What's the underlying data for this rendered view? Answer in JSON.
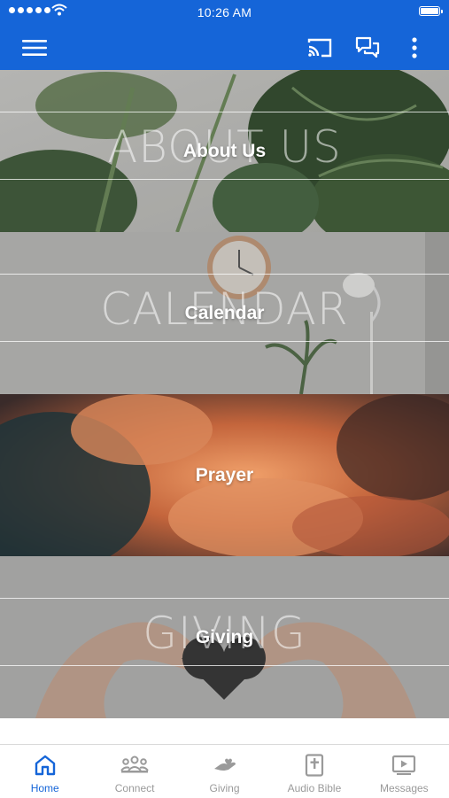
{
  "status_bar": {
    "time": "10:26 AM"
  },
  "nav": {
    "icons": [
      "menu-icon",
      "cast-icon",
      "chat-icon",
      "more-icon"
    ]
  },
  "tiles": [
    {
      "label": "About Us",
      "ghost": "ABOUT US",
      "scene": "monstera leaves"
    },
    {
      "label": "Calendar",
      "ghost": "CALENDAR",
      "scene": "wall clock and lamp"
    },
    {
      "label": "Prayer",
      "ghost": "",
      "scene": "sunset clouds"
    },
    {
      "label": "Giving",
      "ghost": "GIVING",
      "scene": "hands holding heart"
    }
  ],
  "tabbar": {
    "active": "Home",
    "items": [
      {
        "label": "Home",
        "icon": "home-icon"
      },
      {
        "label": "Connect",
        "icon": "people-icon"
      },
      {
        "label": "Giving",
        "icon": "giving-hand-icon"
      },
      {
        "label": "Audio Bible",
        "icon": "bible-icon"
      },
      {
        "label": "Messages",
        "icon": "video-icon"
      }
    ]
  },
  "colors": {
    "brand": "#1565d8",
    "tab_inactive": "#9a9a9a",
    "tab_active": "#1565d8"
  }
}
